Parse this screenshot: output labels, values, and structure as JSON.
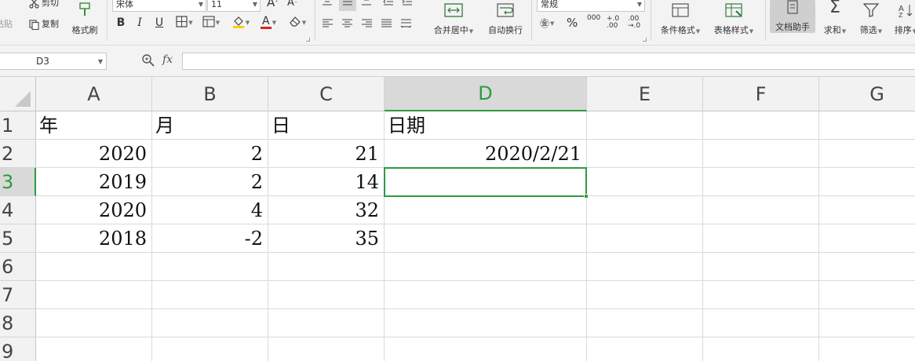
{
  "ribbon": {
    "clipboard": {
      "paste_label": "粘贴",
      "cut_label": "剪切",
      "copy_label": "复制",
      "format_painter_label": "格式刷"
    },
    "font": {
      "font_name": "宋体",
      "font_size": "11",
      "grow_label": "A",
      "shrink_label": "A",
      "bold": "B",
      "italic": "I",
      "underline": "U",
      "font_color_letter": "A"
    },
    "align": {
      "merge_label": "合并居中",
      "wrap_label": "自动换行"
    },
    "number": {
      "format": "常规",
      "percent": "%",
      "thousands": "000",
      "inc_decimal": "+.0\n.00",
      "dec_decimal": ".00\n→.0"
    },
    "styles": {
      "conditional_label": "条件格式",
      "table_style_label": "表格样式",
      "assistant_label": "文档助手",
      "sum_label": "求和",
      "filter_label": "筛选",
      "sort_label": "排序"
    },
    "colors": {
      "accent_green": "#2e9a44",
      "font_red": "#e02020",
      "fill_yellow": "#f6d000"
    }
  },
  "formula_bar": {
    "name_box": "D3",
    "fx_label": "fx",
    "content": ""
  },
  "columns": [
    "A",
    "B",
    "C",
    "D",
    "E",
    "F",
    "G"
  ],
  "selected_column": "D",
  "rows": [
    "1",
    "2",
    "3",
    "4",
    "5",
    "6",
    "7",
    "8",
    "9"
  ],
  "selected_row": "3",
  "cells": {
    "A1": "年",
    "B1": "月",
    "C1": "日",
    "D1": "日期",
    "A2": "2020",
    "B2": "2",
    "C2": "21",
    "D2": "2020/2/21",
    "A3": "2019",
    "B3": "2",
    "C3": "14",
    "D3": "",
    "A4": "2020",
    "B4": "4",
    "C4": "32",
    "A5": "2018",
    "B5": "-2",
    "C5": "35"
  }
}
